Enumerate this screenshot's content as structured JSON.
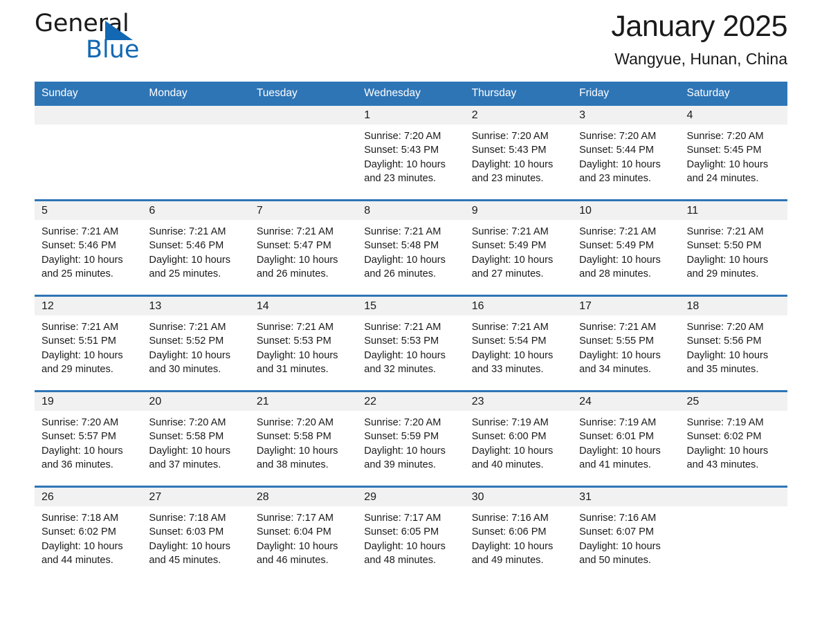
{
  "brand": {
    "name_part1": "General",
    "name_part2": "Blue",
    "accent_color": "#1268b3"
  },
  "header": {
    "title": "January 2025",
    "subtitle": "Wangyue, Hunan, China"
  },
  "theme": {
    "header_blue": "#2e75b6",
    "day_band_gray": "#f1f1f1"
  },
  "weekday_headers": [
    "Sunday",
    "Monday",
    "Tuesday",
    "Wednesday",
    "Thursday",
    "Friday",
    "Saturday"
  ],
  "weeks": [
    [
      {
        "day": "",
        "lines": []
      },
      {
        "day": "",
        "lines": []
      },
      {
        "day": "",
        "lines": []
      },
      {
        "day": "1",
        "lines": [
          "Sunrise: 7:20 AM",
          "Sunset: 5:43 PM",
          "Daylight: 10 hours",
          "and 23 minutes."
        ]
      },
      {
        "day": "2",
        "lines": [
          "Sunrise: 7:20 AM",
          "Sunset: 5:43 PM",
          "Daylight: 10 hours",
          "and 23 minutes."
        ]
      },
      {
        "day": "3",
        "lines": [
          "Sunrise: 7:20 AM",
          "Sunset: 5:44 PM",
          "Daylight: 10 hours",
          "and 23 minutes."
        ]
      },
      {
        "day": "4",
        "lines": [
          "Sunrise: 7:20 AM",
          "Sunset: 5:45 PM",
          "Daylight: 10 hours",
          "and 24 minutes."
        ]
      }
    ],
    [
      {
        "day": "5",
        "lines": [
          "Sunrise: 7:21 AM",
          "Sunset: 5:46 PM",
          "Daylight: 10 hours",
          "and 25 minutes."
        ]
      },
      {
        "day": "6",
        "lines": [
          "Sunrise: 7:21 AM",
          "Sunset: 5:46 PM",
          "Daylight: 10 hours",
          "and 25 minutes."
        ]
      },
      {
        "day": "7",
        "lines": [
          "Sunrise: 7:21 AM",
          "Sunset: 5:47 PM",
          "Daylight: 10 hours",
          "and 26 minutes."
        ]
      },
      {
        "day": "8",
        "lines": [
          "Sunrise: 7:21 AM",
          "Sunset: 5:48 PM",
          "Daylight: 10 hours",
          "and 26 minutes."
        ]
      },
      {
        "day": "9",
        "lines": [
          "Sunrise: 7:21 AM",
          "Sunset: 5:49 PM",
          "Daylight: 10 hours",
          "and 27 minutes."
        ]
      },
      {
        "day": "10",
        "lines": [
          "Sunrise: 7:21 AM",
          "Sunset: 5:49 PM",
          "Daylight: 10 hours",
          "and 28 minutes."
        ]
      },
      {
        "day": "11",
        "lines": [
          "Sunrise: 7:21 AM",
          "Sunset: 5:50 PM",
          "Daylight: 10 hours",
          "and 29 minutes."
        ]
      }
    ],
    [
      {
        "day": "12",
        "lines": [
          "Sunrise: 7:21 AM",
          "Sunset: 5:51 PM",
          "Daylight: 10 hours",
          "and 29 minutes."
        ]
      },
      {
        "day": "13",
        "lines": [
          "Sunrise: 7:21 AM",
          "Sunset: 5:52 PM",
          "Daylight: 10 hours",
          "and 30 minutes."
        ]
      },
      {
        "day": "14",
        "lines": [
          "Sunrise: 7:21 AM",
          "Sunset: 5:53 PM",
          "Daylight: 10 hours",
          "and 31 minutes."
        ]
      },
      {
        "day": "15",
        "lines": [
          "Sunrise: 7:21 AM",
          "Sunset: 5:53 PM",
          "Daylight: 10 hours",
          "and 32 minutes."
        ]
      },
      {
        "day": "16",
        "lines": [
          "Sunrise: 7:21 AM",
          "Sunset: 5:54 PM",
          "Daylight: 10 hours",
          "and 33 minutes."
        ]
      },
      {
        "day": "17",
        "lines": [
          "Sunrise: 7:21 AM",
          "Sunset: 5:55 PM",
          "Daylight: 10 hours",
          "and 34 minutes."
        ]
      },
      {
        "day": "18",
        "lines": [
          "Sunrise: 7:20 AM",
          "Sunset: 5:56 PM",
          "Daylight: 10 hours",
          "and 35 minutes."
        ]
      }
    ],
    [
      {
        "day": "19",
        "lines": [
          "Sunrise: 7:20 AM",
          "Sunset: 5:57 PM",
          "Daylight: 10 hours",
          "and 36 minutes."
        ]
      },
      {
        "day": "20",
        "lines": [
          "Sunrise: 7:20 AM",
          "Sunset: 5:58 PM",
          "Daylight: 10 hours",
          "and 37 minutes."
        ]
      },
      {
        "day": "21",
        "lines": [
          "Sunrise: 7:20 AM",
          "Sunset: 5:58 PM",
          "Daylight: 10 hours",
          "and 38 minutes."
        ]
      },
      {
        "day": "22",
        "lines": [
          "Sunrise: 7:20 AM",
          "Sunset: 5:59 PM",
          "Daylight: 10 hours",
          "and 39 minutes."
        ]
      },
      {
        "day": "23",
        "lines": [
          "Sunrise: 7:19 AM",
          "Sunset: 6:00 PM",
          "Daylight: 10 hours",
          "and 40 minutes."
        ]
      },
      {
        "day": "24",
        "lines": [
          "Sunrise: 7:19 AM",
          "Sunset: 6:01 PM",
          "Daylight: 10 hours",
          "and 41 minutes."
        ]
      },
      {
        "day": "25",
        "lines": [
          "Sunrise: 7:19 AM",
          "Sunset: 6:02 PM",
          "Daylight: 10 hours",
          "and 43 minutes."
        ]
      }
    ],
    [
      {
        "day": "26",
        "lines": [
          "Sunrise: 7:18 AM",
          "Sunset: 6:02 PM",
          "Daylight: 10 hours",
          "and 44 minutes."
        ]
      },
      {
        "day": "27",
        "lines": [
          "Sunrise: 7:18 AM",
          "Sunset: 6:03 PM",
          "Daylight: 10 hours",
          "and 45 minutes."
        ]
      },
      {
        "day": "28",
        "lines": [
          "Sunrise: 7:17 AM",
          "Sunset: 6:04 PM",
          "Daylight: 10 hours",
          "and 46 minutes."
        ]
      },
      {
        "day": "29",
        "lines": [
          "Sunrise: 7:17 AM",
          "Sunset: 6:05 PM",
          "Daylight: 10 hours",
          "and 48 minutes."
        ]
      },
      {
        "day": "30",
        "lines": [
          "Sunrise: 7:16 AM",
          "Sunset: 6:06 PM",
          "Daylight: 10 hours",
          "and 49 minutes."
        ]
      },
      {
        "day": "31",
        "lines": [
          "Sunrise: 7:16 AM",
          "Sunset: 6:07 PM",
          "Daylight: 10 hours",
          "and 50 minutes."
        ]
      },
      {
        "day": "",
        "lines": []
      }
    ]
  ]
}
